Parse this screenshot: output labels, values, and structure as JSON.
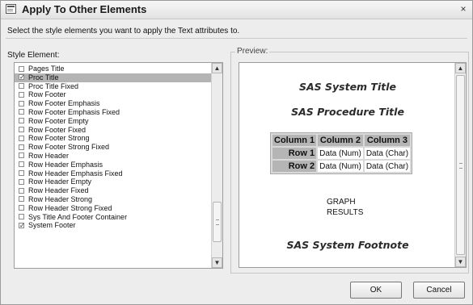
{
  "dialog": {
    "title": "Apply To Other Elements",
    "close_glyph": "×",
    "instruction": "Select the style elements you want to apply the Text attributes to."
  },
  "style_element": {
    "label": "Style Element:",
    "items": [
      {
        "label": "Pages Title",
        "checked": false,
        "selected": false
      },
      {
        "label": "Proc Title",
        "checked": true,
        "selected": true
      },
      {
        "label": "Proc Title Fixed",
        "checked": false,
        "selected": false
      },
      {
        "label": "Row Footer",
        "checked": false,
        "selected": false
      },
      {
        "label": "Row Footer Emphasis",
        "checked": false,
        "selected": false
      },
      {
        "label": "Row Footer Emphasis Fixed",
        "checked": false,
        "selected": false
      },
      {
        "label": "Row Footer Empty",
        "checked": false,
        "selected": false
      },
      {
        "label": "Row Footer Fixed",
        "checked": false,
        "selected": false
      },
      {
        "label": "Row Footer Strong",
        "checked": false,
        "selected": false
      },
      {
        "label": "Row Footer Strong Fixed",
        "checked": false,
        "selected": false
      },
      {
        "label": "Row Header",
        "checked": false,
        "selected": false
      },
      {
        "label": "Row Header Emphasis",
        "checked": false,
        "selected": false
      },
      {
        "label": "Row Header Emphasis Fixed",
        "checked": false,
        "selected": false
      },
      {
        "label": "Row Header Empty",
        "checked": false,
        "selected": false
      },
      {
        "label": "Row Header Fixed",
        "checked": false,
        "selected": false
      },
      {
        "label": "Row Header Strong",
        "checked": false,
        "selected": false
      },
      {
        "label": "Row Header Strong Fixed",
        "checked": false,
        "selected": false
      },
      {
        "label": "Sys Title And Footer Container",
        "checked": false,
        "selected": false
      },
      {
        "label": "System Footer",
        "checked": true,
        "selected": false
      }
    ],
    "scroll_position": 0.9
  },
  "preview": {
    "label": "Preview:",
    "system_title": "SAS System Title",
    "procedure_title": "SAS Procedure Title",
    "table": {
      "columns": [
        "Column 1",
        "Column 2",
        "Column 3"
      ],
      "rows": [
        {
          "header": "Row 1",
          "cells": [
            "Data (Num)",
            "Data (Char)"
          ]
        },
        {
          "header": "Row 2",
          "cells": [
            "Data (Num)",
            "Data (Char)"
          ]
        }
      ]
    },
    "graph_lines": [
      "GRAPH",
      "RESULTS"
    ],
    "footnote": "SAS System Footnote"
  },
  "buttons": {
    "ok": "OK",
    "cancel": "Cancel"
  },
  "glyphs": {
    "check": "✓",
    "up": "▲",
    "down": "▼"
  }
}
